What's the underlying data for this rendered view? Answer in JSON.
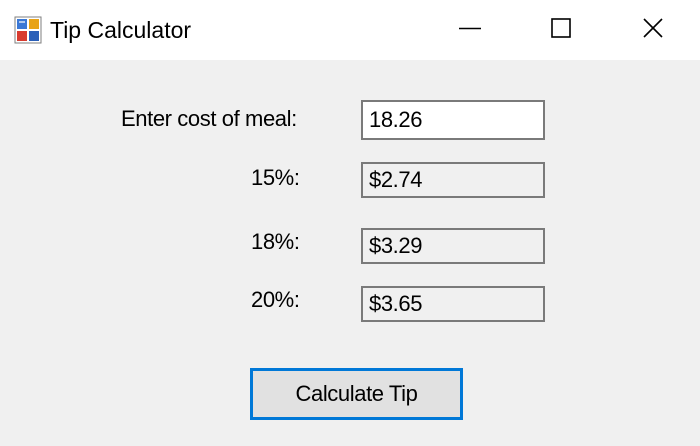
{
  "window": {
    "title": "Tip Calculator",
    "icon": "windows-form-app-icon",
    "controls": {
      "minimize_icon": "minimize-icon",
      "maximize_icon": "maximize-icon",
      "close_icon": "close-icon"
    }
  },
  "form": {
    "meal_label": "Enter cost of meal:",
    "meal_value": "18.26",
    "tips": [
      {
        "label": "15%:",
        "value": "$2.74"
      },
      {
        "label": "18%:",
        "value": "$3.29"
      },
      {
        "label": "20%:",
        "value": "$3.65"
      }
    ],
    "calculate_label": "Calculate Tip"
  },
  "colors": {
    "titlebar_bg": "#ffffff",
    "form_bg": "#f0f0f0",
    "focus_border": "#0078d7",
    "field_border": "#7a7a7a",
    "button_bg": "#e1e1e1"
  }
}
